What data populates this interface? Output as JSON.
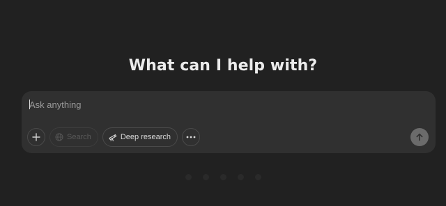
{
  "main": {
    "headline": "What can I help with?"
  },
  "composer": {
    "placeholder": "Ask anything",
    "value": "",
    "tools": {
      "add_icon": "plus-icon",
      "search_label": "Search",
      "search_icon": "globe-icon",
      "deep_research_label": "Deep research",
      "deep_research_icon": "telescope-icon",
      "more_icon": "ellipsis-icon"
    },
    "send_icon": "arrow-up-icon"
  },
  "colors": {
    "background": "#212121",
    "composer": "#303030",
    "send_button": "#6b6b6b"
  }
}
